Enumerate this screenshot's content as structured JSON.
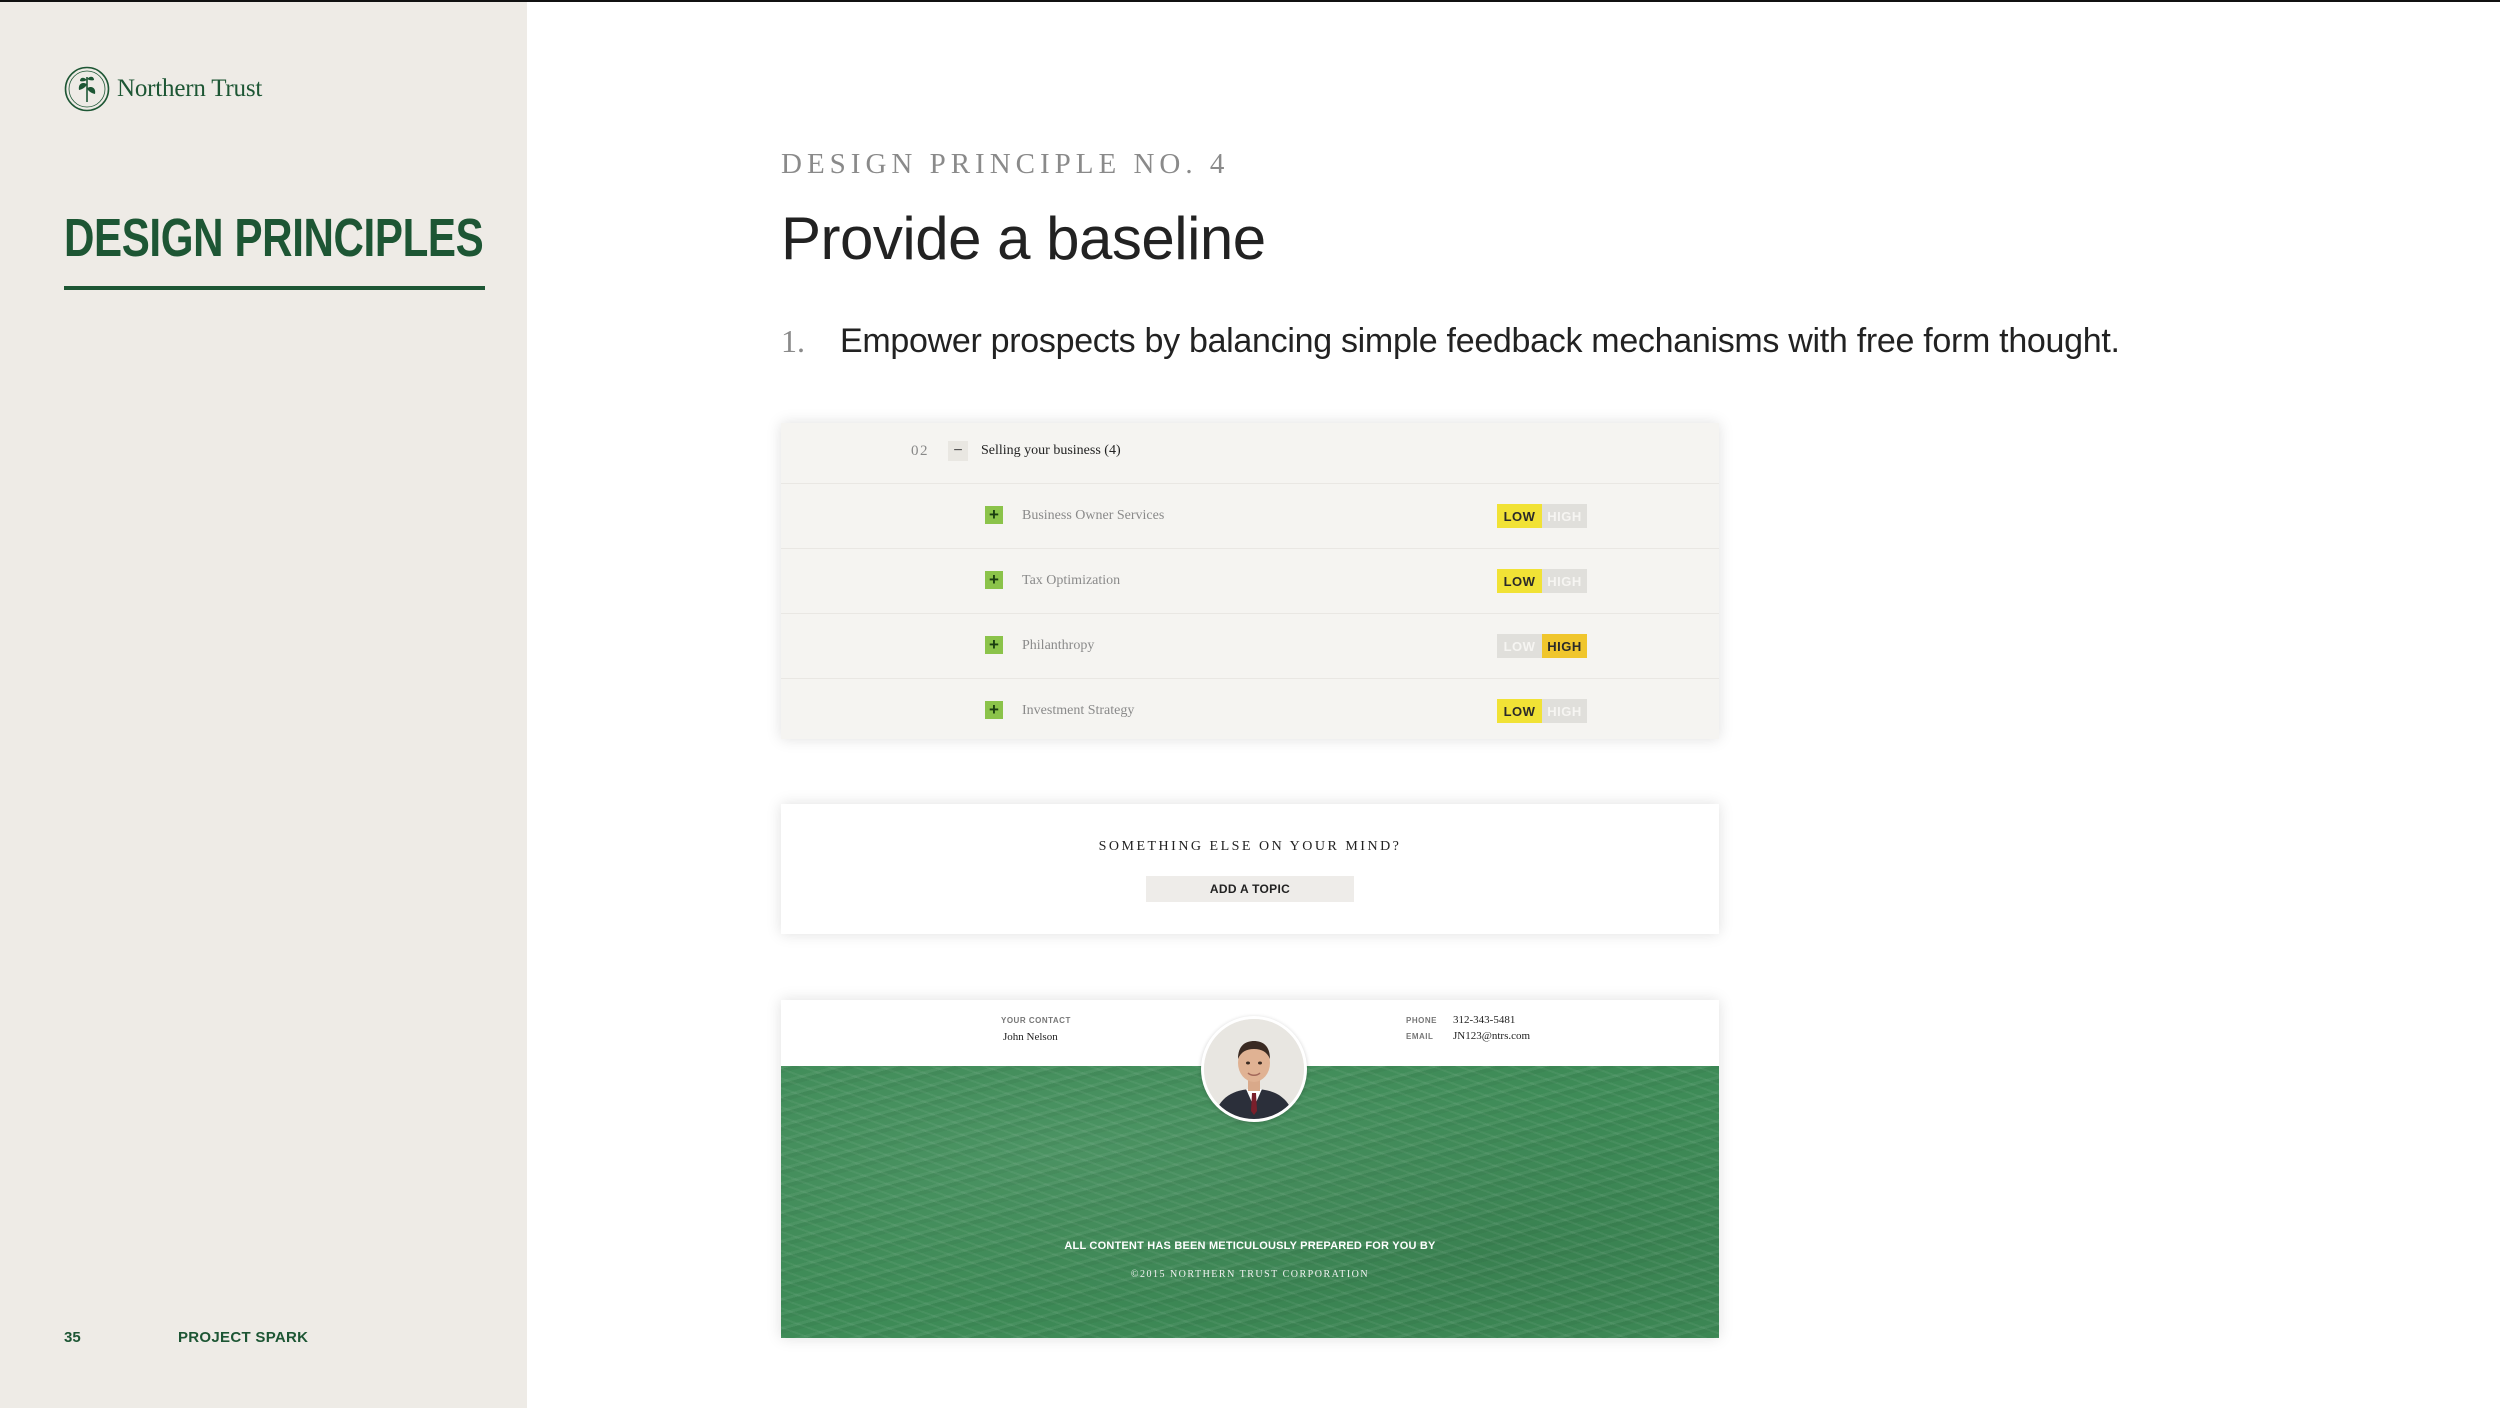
{
  "brand": {
    "name": "Northern Trust",
    "logo_icon": "northern-trust-seal-icon"
  },
  "sidebar": {
    "section_title": "DESIGN PRINCIPLES",
    "page_number": "35",
    "project_name": "PROJECT SPARK"
  },
  "main": {
    "eyebrow": "DESIGN PRINCIPLE NO. 4",
    "headline": "Provide a baseline",
    "points": [
      {
        "number": "1.",
        "text": "Empower prospects by balancing simple feedback mechanisms with free form thought."
      }
    ]
  },
  "topics_card": {
    "section_number": "02",
    "collapse_symbol": "−",
    "section_title": "Selling your business (4)",
    "add_symbol": "+",
    "toggle_low_label": "LOW",
    "toggle_high_label": "HIGH",
    "rows": [
      {
        "label": "Business Owner Services",
        "selected": "LOW"
      },
      {
        "label": "Tax Optimization",
        "selected": "LOW"
      },
      {
        "label": "Philanthropy",
        "selected": "HIGH"
      },
      {
        "label": "Investment Strategy",
        "selected": "LOW"
      }
    ]
  },
  "add_card": {
    "question": "SOMETHING ELSE ON YOUR MIND?",
    "button_label": "ADD A TOPIC"
  },
  "contact_card": {
    "contact_label": "YOUR CONTACT",
    "contact_name": "John Nelson",
    "phone_label": "PHONE",
    "phone_value": "312-343-5481",
    "email_label": "EMAIL",
    "email_value": "JN123@ntrs.com",
    "avatar_icon": "advisor-portrait",
    "footer_line1": "ALL CONTENT HAS BEEN METICULOUSLY PREPARED FOR YOU BY",
    "footer_line2": "©2015 NORTHERN TRUST CORPORATION"
  },
  "colors": {
    "brand_green": "#1d5634",
    "toggle_low_active": "#f1e235",
    "toggle_high_active": "#f0c62d",
    "add_button": "#8bc34a",
    "footer_green": "#3e8b57"
  }
}
